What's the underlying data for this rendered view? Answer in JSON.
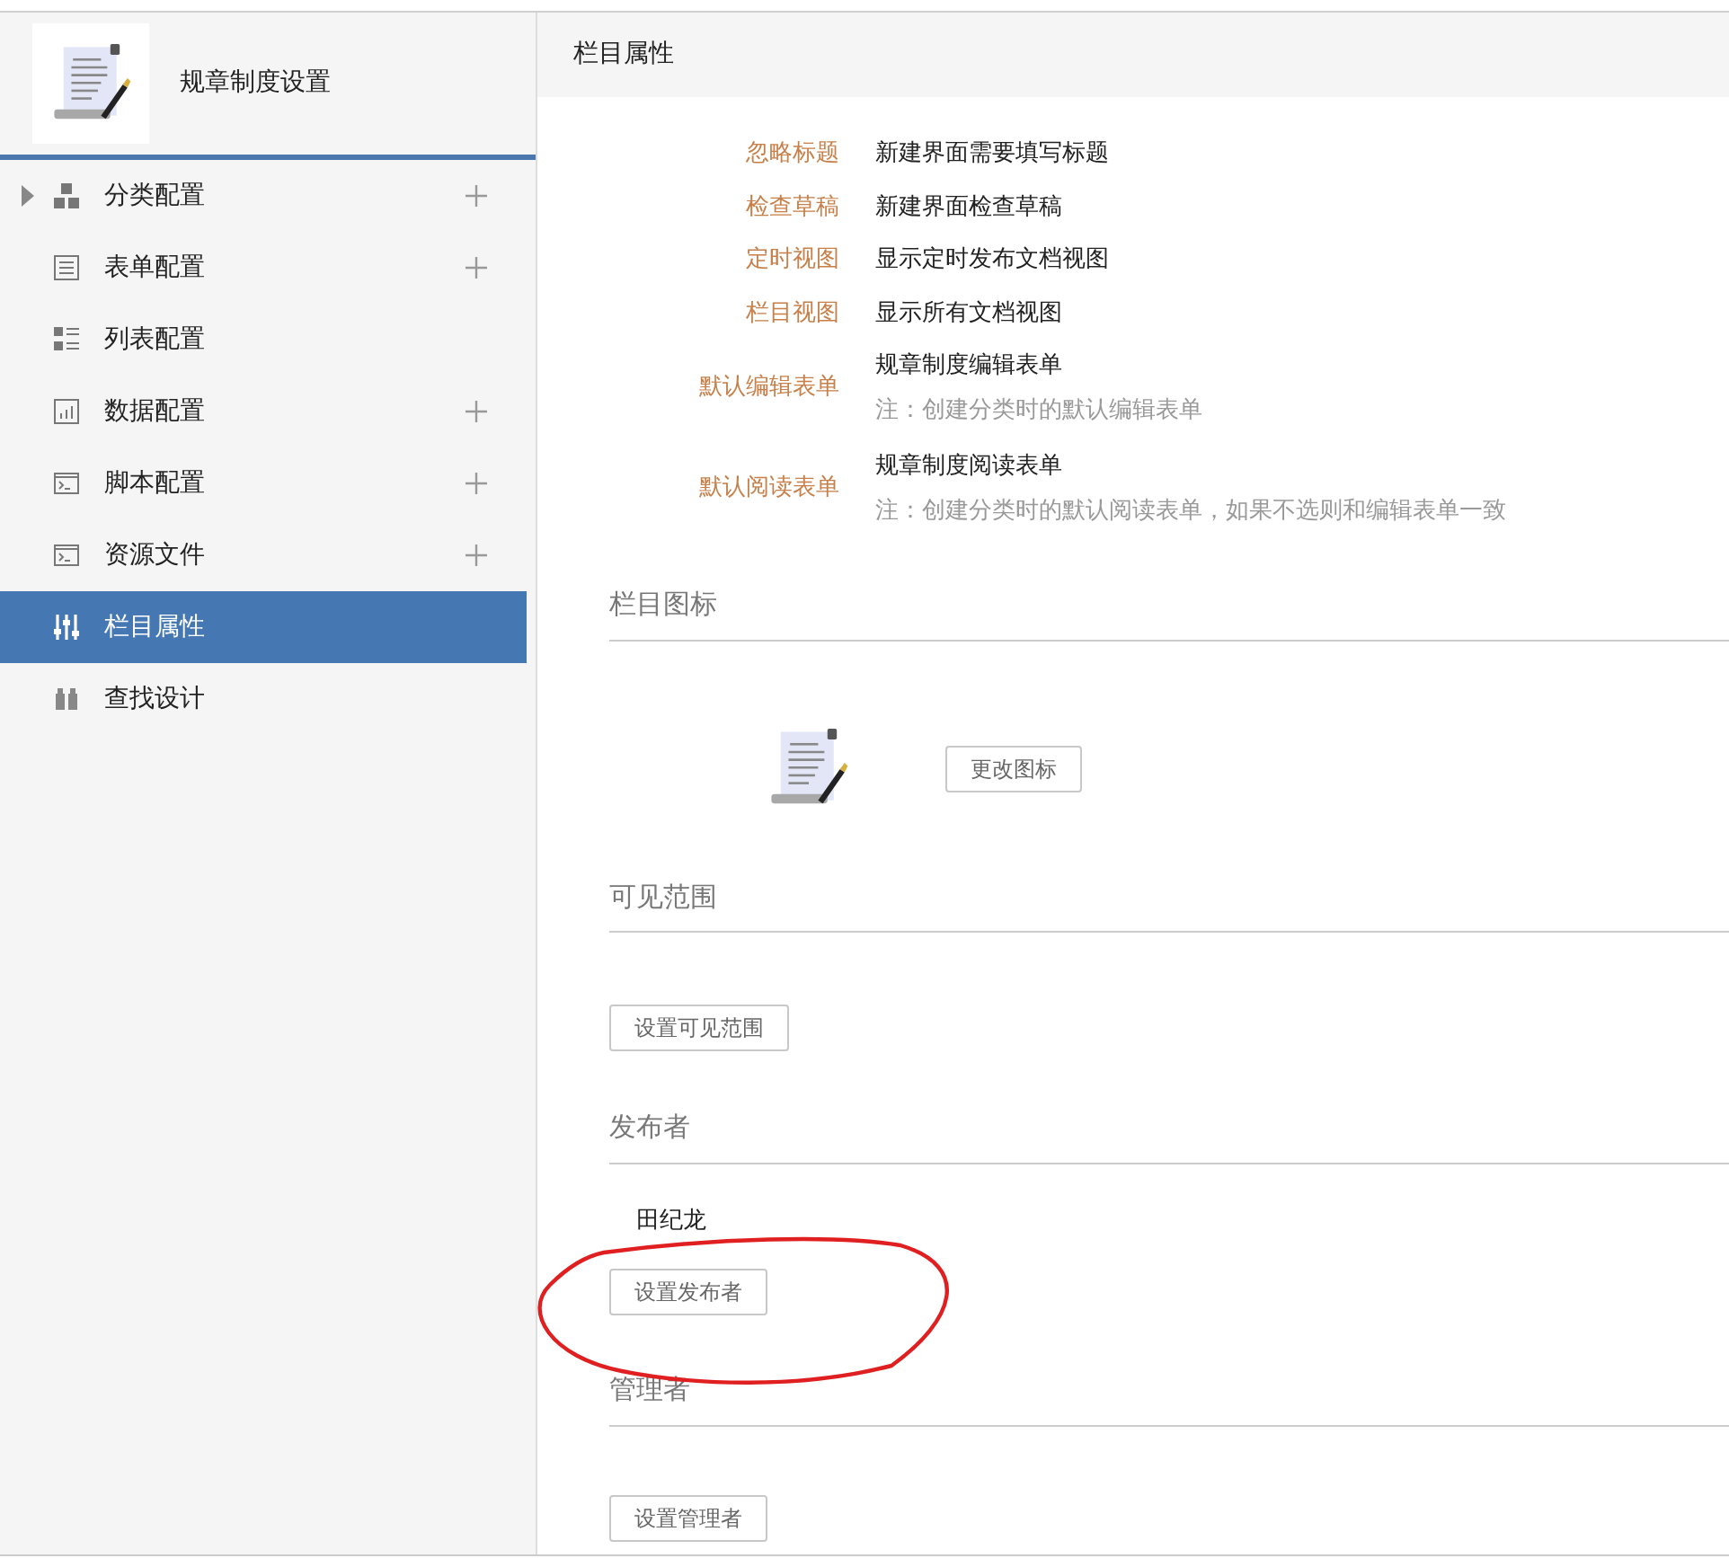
{
  "sidebar": {
    "title": "规章制度设置",
    "items": [
      {
        "label": "分类配置",
        "selected": false,
        "expandable": true,
        "addable": true
      },
      {
        "label": "表单配置",
        "selected": false,
        "expandable": false,
        "addable": true
      },
      {
        "label": "列表配置",
        "selected": false,
        "expandable": false,
        "addable": false
      },
      {
        "label": "数据配置",
        "selected": false,
        "expandable": false,
        "addable": true
      },
      {
        "label": "脚本配置",
        "selected": false,
        "expandable": false,
        "addable": true
      },
      {
        "label": "资源文件",
        "selected": false,
        "expandable": false,
        "addable": true
      },
      {
        "label": "栏目属性",
        "selected": true,
        "expandable": false,
        "addable": false
      },
      {
        "label": "查找设计",
        "selected": false,
        "expandable": false,
        "addable": false
      }
    ]
  },
  "panel": {
    "title": "栏目属性",
    "properties": [
      {
        "label": "忽略标题",
        "value": "新建界面需要填写标题"
      },
      {
        "label": "检查草稿",
        "value": "新建界面检查草稿"
      },
      {
        "label": "定时视图",
        "value": "显示定时发布文档视图"
      },
      {
        "label": "栏目视图",
        "value": "显示所有文档视图"
      },
      {
        "label": "默认编辑表单",
        "value": "规章制度编辑表单",
        "note": "注：创建分类时的默认编辑表单"
      },
      {
        "label": "默认阅读表单",
        "value": "规章制度阅读表单",
        "note": "注：创建分类时的默认阅读表单，如果不选则和编辑表单一致"
      }
    ],
    "sections": [
      {
        "kind": "icon",
        "title": "栏目图标",
        "button": "更改图标"
      },
      {
        "kind": "scope",
        "title": "可见范围",
        "button": "设置可见范围"
      },
      {
        "kind": "people",
        "title": "发布者",
        "value": "田纪龙",
        "button": "设置发布者",
        "circled": true
      },
      {
        "kind": "people",
        "title": "管理者",
        "button": "设置管理者",
        "circled": false
      }
    ]
  }
}
